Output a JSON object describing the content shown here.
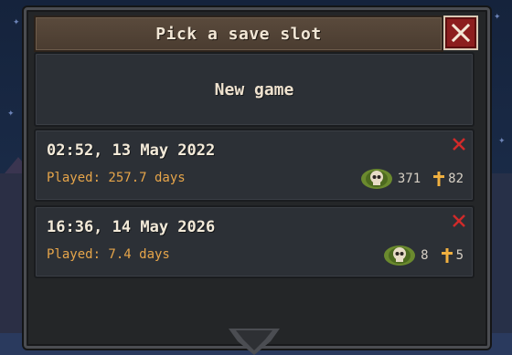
{
  "dialog": {
    "title": "Pick a save slot",
    "close_icon": "close-icon",
    "new_game_label": "New game"
  },
  "slots": [
    {
      "date": "02:52, 13 May 2022",
      "played": "Played: 257.7 days",
      "kills": "371",
      "deaths": "82"
    },
    {
      "date": "16:36, 14 May 2026",
      "played": "Played: 7.4 days",
      "kills": "8",
      "deaths": "5"
    }
  ],
  "colors": {
    "title_bar": "#5a4a3c",
    "close_button": "#8c1e1e",
    "played_text": "#e6a54a",
    "delete_x": "#d12a2a",
    "skull_badge": "#6b8a2e",
    "cross": "#f0b040"
  }
}
